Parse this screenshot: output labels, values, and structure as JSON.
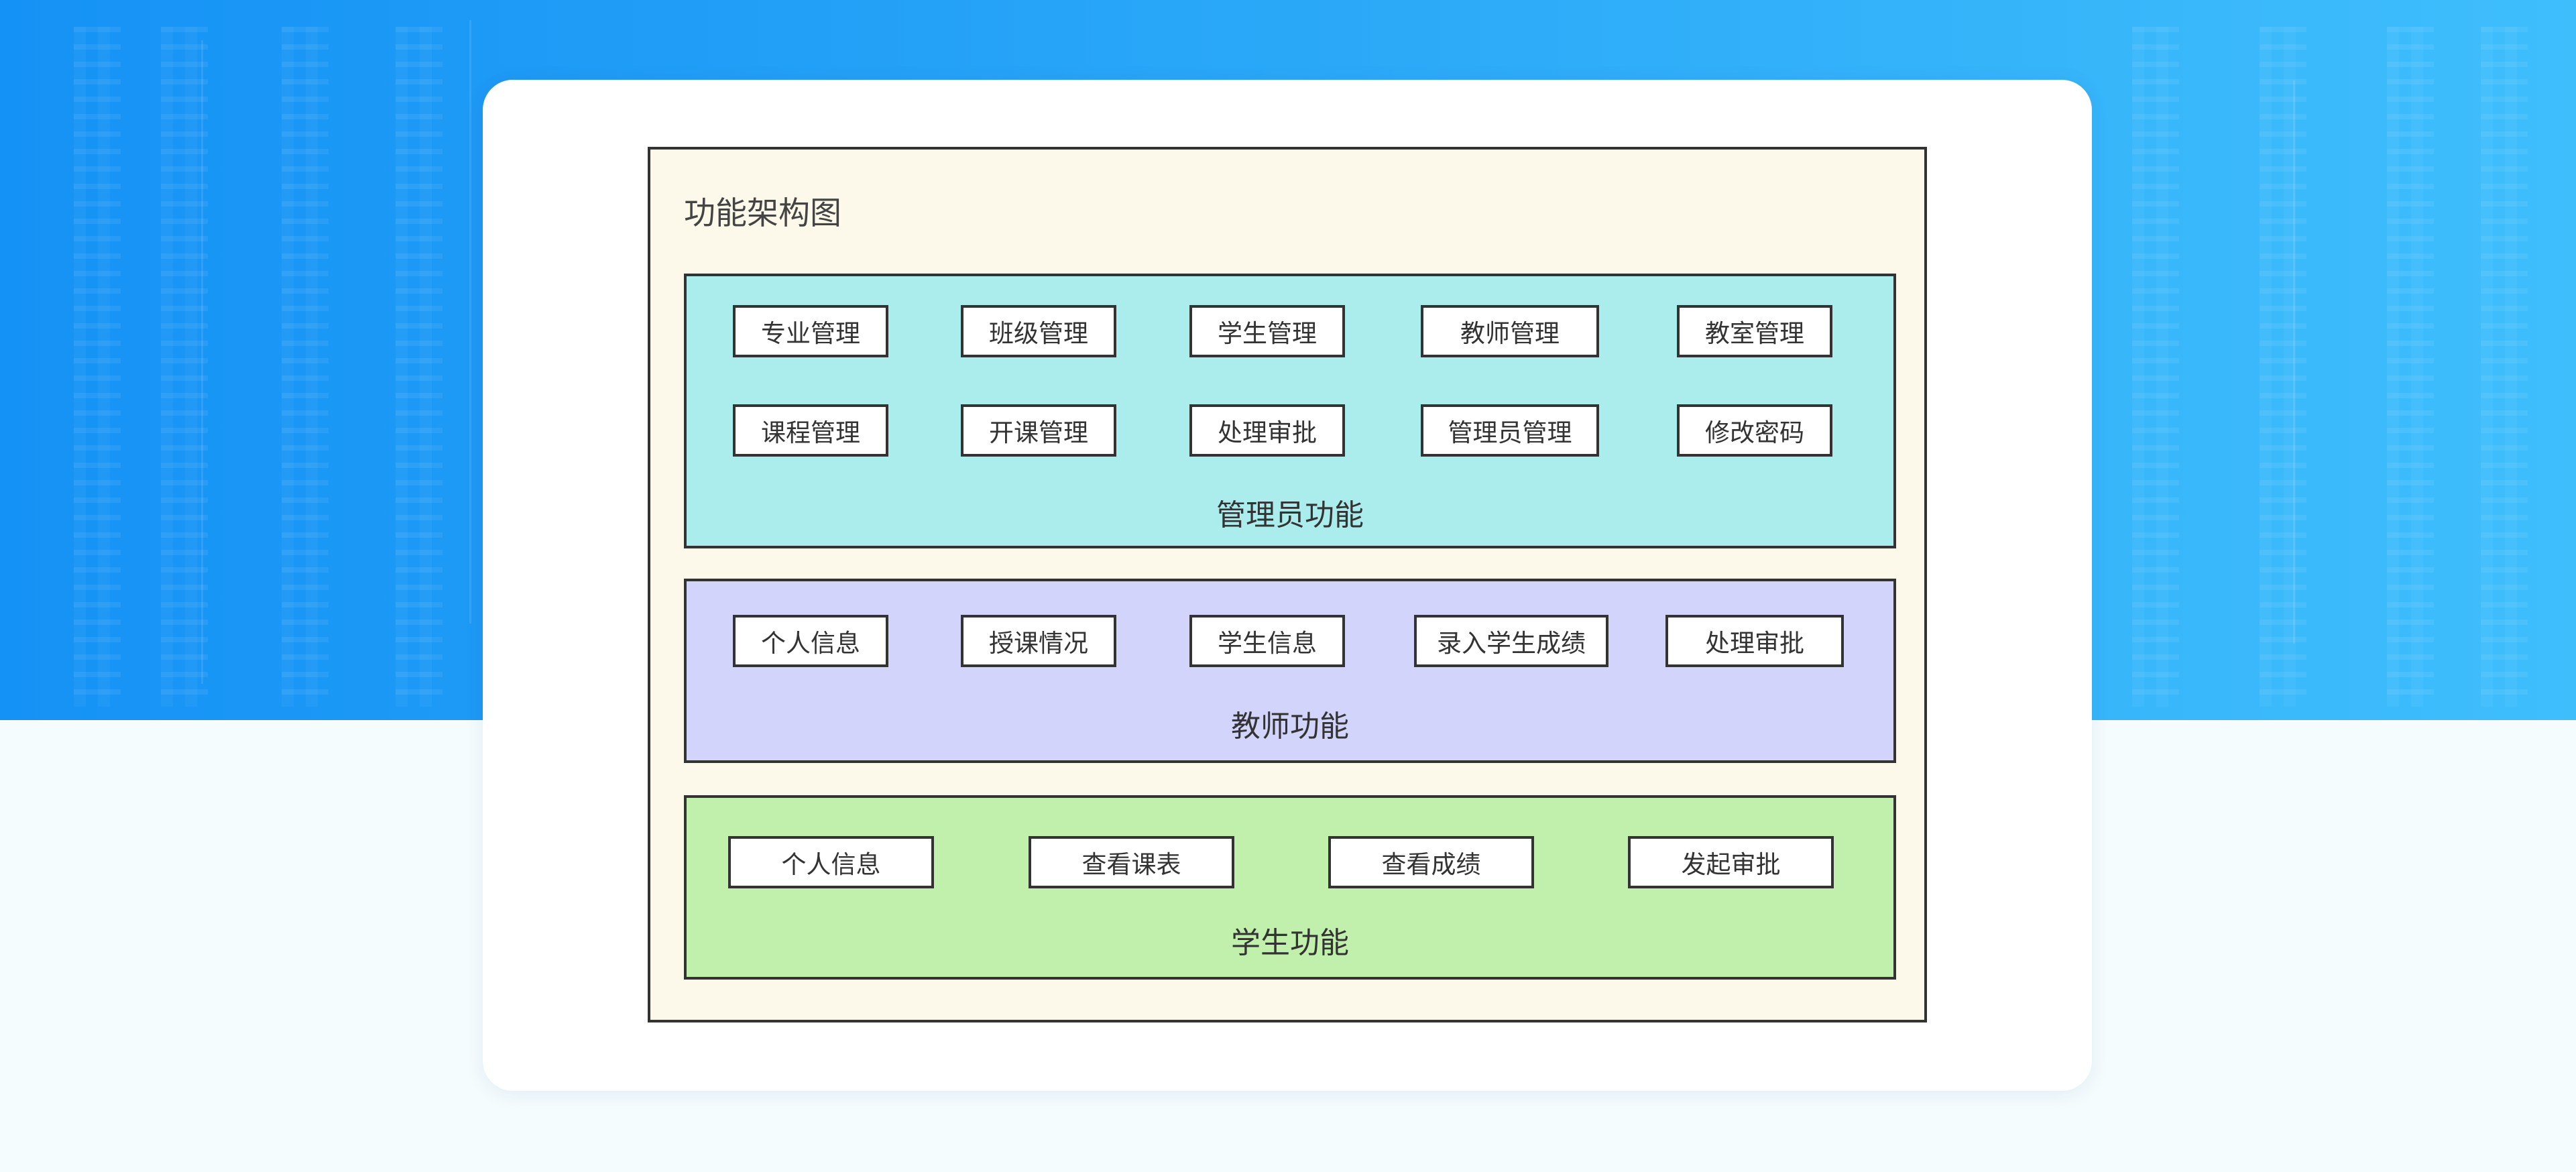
{
  "diagram": {
    "title": "功能架构图",
    "groups": {
      "admin": {
        "label": "管理员功能",
        "items": [
          "专业管理",
          "班级管理",
          "学生管理",
          "教师管理",
          "教室管理",
          "课程管理",
          "开课管理",
          "处理审批",
          "管理员管理",
          "修改密码"
        ]
      },
      "teacher": {
        "label": "教师功能",
        "items": [
          "个人信息",
          "授课情况",
          "学生信息",
          "录入学生成绩",
          "处理审批"
        ]
      },
      "student": {
        "label": "学生功能",
        "items": [
          "个人信息",
          "查看课表",
          "查看成绩",
          "发起审批"
        ]
      }
    }
  },
  "colors": {
    "background_gradient_start": "#1592f5",
    "background_gradient_end": "#3fbefc",
    "diagram_frame": "#fcf9ea",
    "admin_group": "#aaedec",
    "teacher_group": "#d2d4fb",
    "student_group": "#c1f0ad"
  }
}
